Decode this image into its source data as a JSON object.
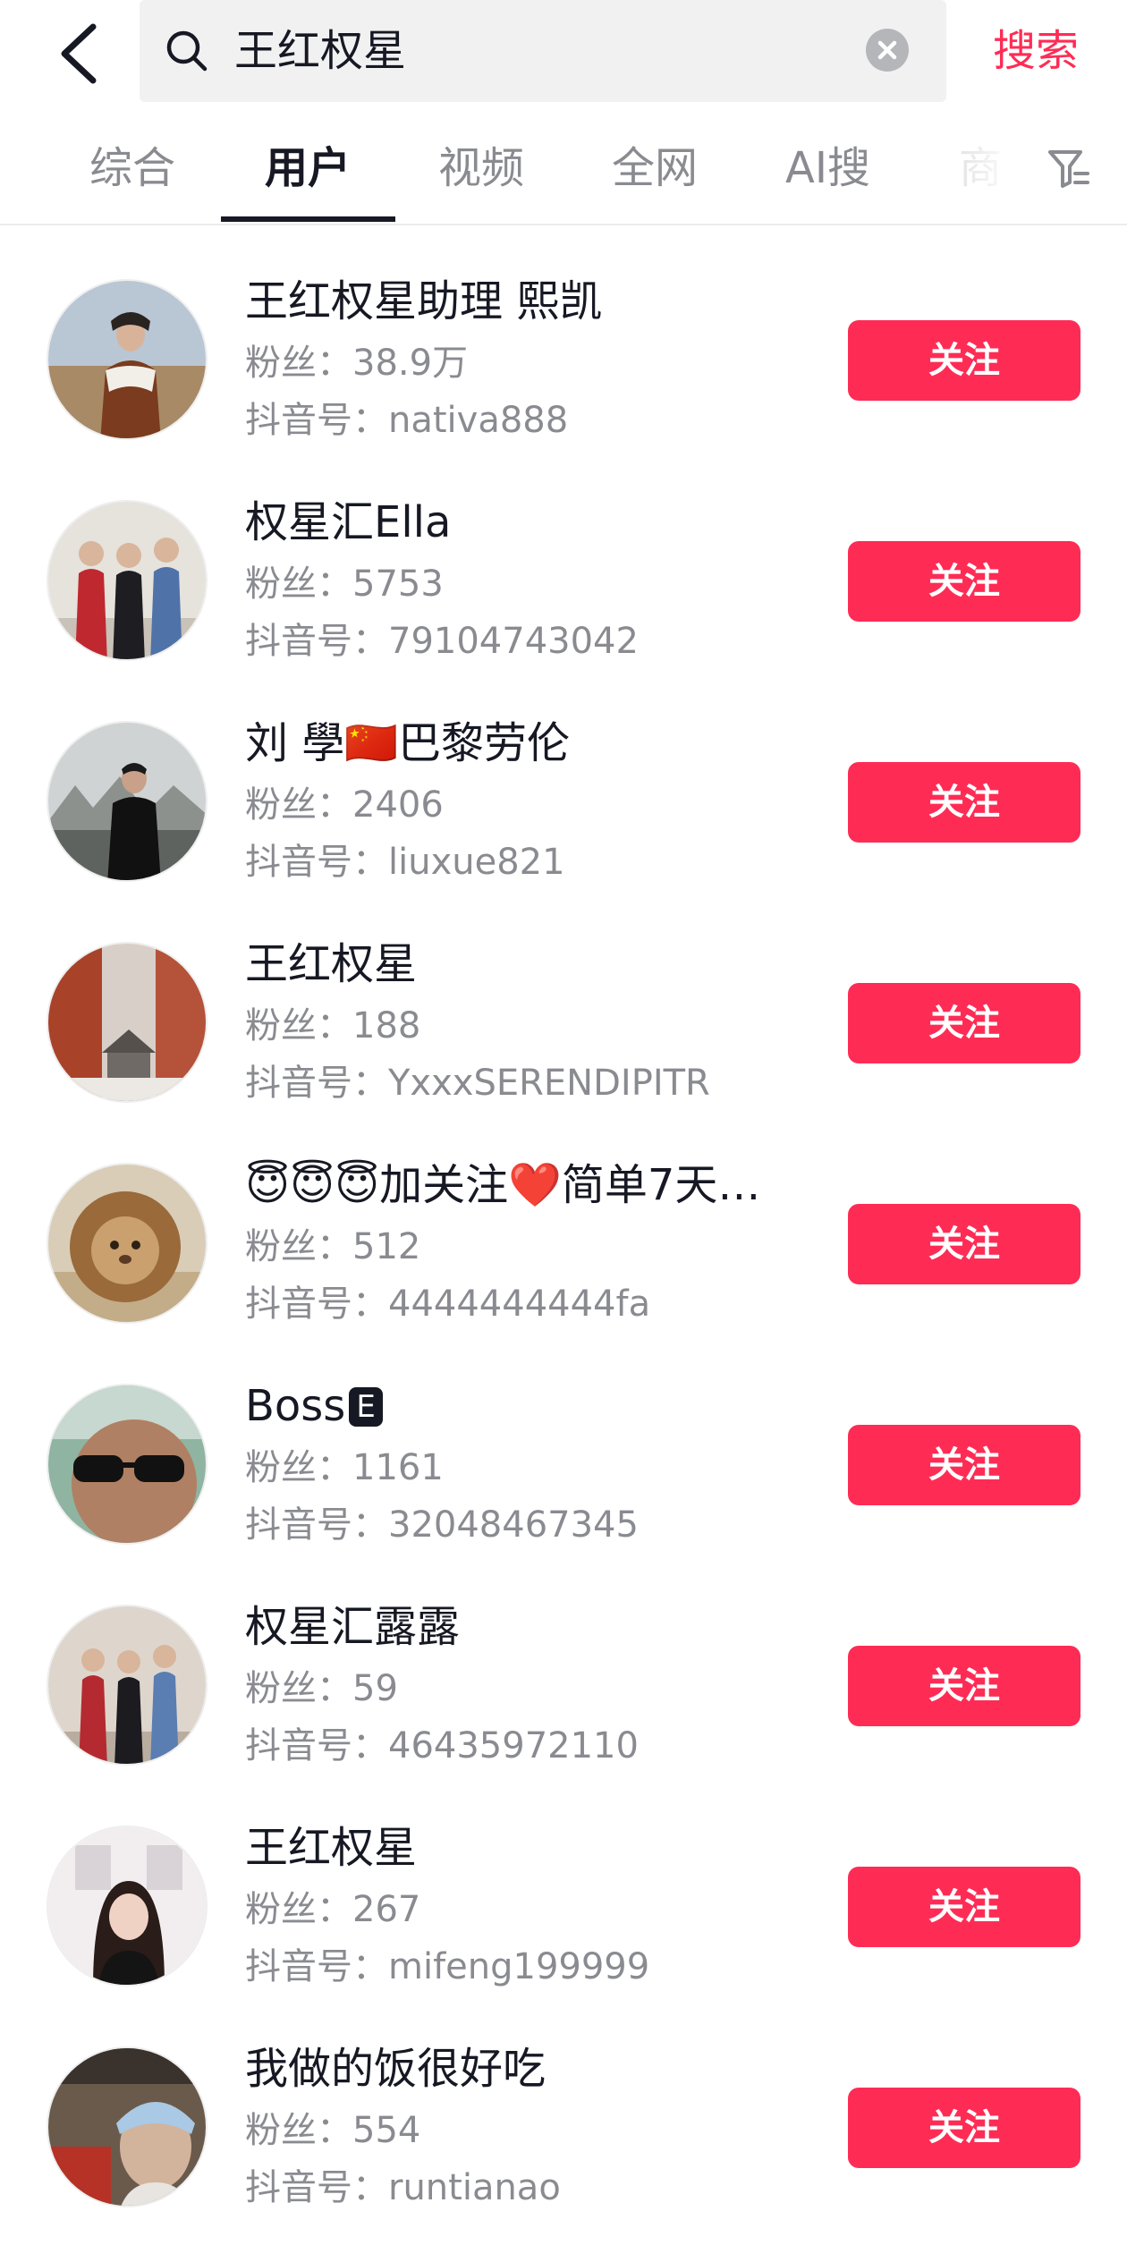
{
  "search": {
    "query": "王红权星",
    "submit_label": "搜索"
  },
  "tabs": [
    {
      "label": "综合",
      "active": false
    },
    {
      "label": "用户",
      "active": true
    },
    {
      "label": "视频",
      "active": false
    },
    {
      "label": "全网",
      "active": false
    },
    {
      "label": "AI搜",
      "active": false
    },
    {
      "label": "商",
      "active": false
    }
  ],
  "colors": {
    "accent": "#fe2c55",
    "text": "#161823",
    "secondary": "#8a8b91"
  },
  "users": [
    {
      "nickname": "王红权星助理 熙凯",
      "fans_label": "粉丝：",
      "fans": "38.9万",
      "uid_label": "抖音号：",
      "uid": "nativa888",
      "follow": "关注"
    },
    {
      "nickname": "权星汇Ella",
      "fans_label": "粉丝：",
      "fans": "5753",
      "uid_label": "抖音号：",
      "uid": "79104743042",
      "follow": "关注"
    },
    {
      "nickname": "刘 學🇨🇳巴黎劳伦",
      "fans_label": "粉丝：",
      "fans": "2406",
      "uid_label": "抖音号：",
      "uid": "liuxue821",
      "follow": "关注"
    },
    {
      "nickname": "王红权星",
      "fans_label": "粉丝：",
      "fans": "188",
      "uid_label": "抖音号：",
      "uid": "YxxxSERENDIPITR",
      "follow": "关注"
    },
    {
      "nickname": "😇😇😇加关注❤️简单7天…",
      "fans_label": "粉丝：",
      "fans": "512",
      "uid_label": "抖音号：",
      "uid": "4444444444fa",
      "follow": "关注"
    },
    {
      "nickname": "Boss",
      "badge": "E",
      "fans_label": "粉丝：",
      "fans": "1161",
      "uid_label": "抖音号：",
      "uid": "32048467345",
      "follow": "关注"
    },
    {
      "nickname": "权星汇露露",
      "fans_label": "粉丝：",
      "fans": "59",
      "uid_label": "抖音号：",
      "uid": "46435972110",
      "follow": "关注"
    },
    {
      "nickname": "王红权星",
      "fans_label": "粉丝：",
      "fans": "267",
      "uid_label": "抖音号：",
      "uid": "mifeng199999",
      "follow": "关注"
    },
    {
      "nickname": "我做的饭很好吃",
      "fans_label": "粉丝：",
      "fans": "554",
      "uid_label": "抖音号：",
      "uid": "runtianao",
      "follow": "关注"
    }
  ]
}
